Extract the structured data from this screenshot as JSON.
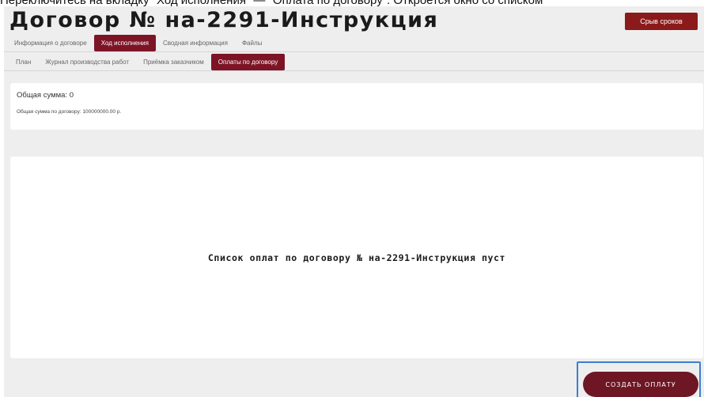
{
  "top_cutoff_text": "Переключитесь на вкладку \"Ход исполнения\" — \"Оплата по договору\". Откроется окно со списком",
  "header": {
    "title": "Договор № на-2291-Инструкция",
    "delay_button": "Срыв сроков"
  },
  "tabs_main": [
    {
      "label": "Информация о договоре",
      "active": false
    },
    {
      "label": "Ход исполнения",
      "active": true
    },
    {
      "label": "Сводная информация",
      "active": false
    },
    {
      "label": "Файлы",
      "active": false
    }
  ],
  "tabs_sub": [
    {
      "label": "План",
      "active": false
    },
    {
      "label": "Журнал производства работ",
      "active": false
    },
    {
      "label": "Приёмка заказчиком",
      "active": false
    },
    {
      "label": "Оплаты по договору",
      "active": true
    }
  ],
  "summary": {
    "total": "Общая сумма: 0",
    "contract_total": "Общая сумма по договору: 100000000.00 р."
  },
  "payments": {
    "empty_message": "Список оплат по договору № на-2291-Инструкция пуст",
    "create_button": "СОЗДАТЬ ОПЛАТУ"
  },
  "colors": {
    "accent": "#7d1426",
    "delay_button": "#8b1a1a",
    "focus_outline": "#3a7fd0",
    "page_background": "#eeeeee"
  }
}
